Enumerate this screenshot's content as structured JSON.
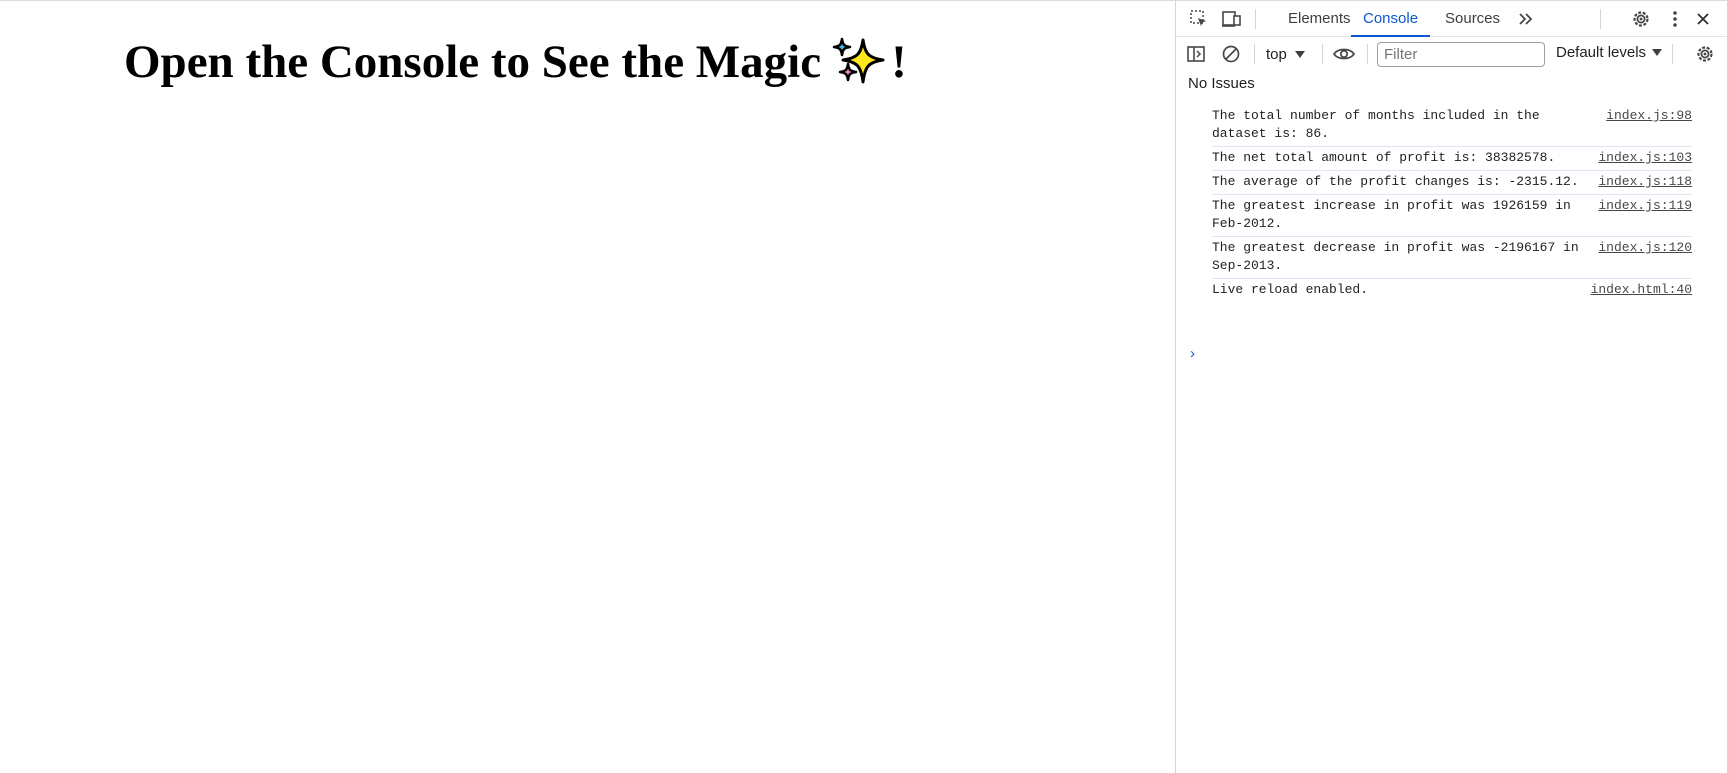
{
  "page": {
    "heading_before": "Open the Console to See the Magic",
    "heading_after": "!"
  },
  "devtools": {
    "tabs": [
      {
        "label": "Elements"
      },
      {
        "label": "Console"
      },
      {
        "label": "Sources"
      }
    ],
    "active_tab": "Console",
    "toolbar": {
      "context": "top",
      "filter_placeholder": "Filter",
      "filter_value": "",
      "levels": "Default levels"
    },
    "issues_text": "No Issues",
    "messages": [
      {
        "text": "The total number of months included in the dataset is: 86.",
        "source": "index.js:98"
      },
      {
        "text": "The net total amount of profit is: 38382578.",
        "source": "index.js:103"
      },
      {
        "text": "The average of the profit changes is: -2315.12.",
        "source": "index.js:118"
      },
      {
        "text": "The greatest increase in profit was 1926159 in Feb-2012.",
        "source": "index.js:119"
      },
      {
        "text": "The greatest decrease in profit was -2196167 in Sep-2013.",
        "source": "index.js:120"
      },
      {
        "text": "Live reload enabled.",
        "source": "index.html:40"
      }
    ],
    "prompt_symbol": "›",
    "colors": {
      "accent": "#0b57d0",
      "divider": "#dbe6f3",
      "text": "#1f1f1f"
    },
    "icons": [
      "inspect-element-icon",
      "device-toolbar-icon",
      "more-tabs-icon",
      "settings-icon",
      "kebab-menu-icon",
      "close-icon",
      "sidebar-toggle-icon",
      "clear-console-icon",
      "live-expression-eye-icon",
      "console-settings-icon",
      "sparkles-icon"
    ]
  }
}
